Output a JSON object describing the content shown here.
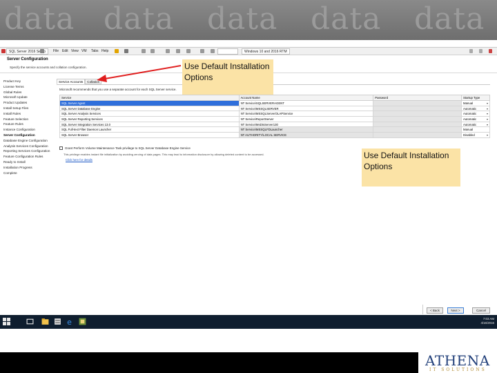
{
  "banner": {
    "watermark": [
      "data",
      "data",
      "data",
      "data",
      "data"
    ]
  },
  "window": {
    "menu": {
      "app_tab": "SQL Server 2016 Setup",
      "items": [
        "File",
        "Edit",
        "View",
        "VM",
        "Tabs",
        "Help"
      ],
      "vm_tab": "Windows 10 and 2016 RTM"
    },
    "header": {
      "title": "Server Configuration",
      "description": "Specify the service accounts and collation configuration."
    },
    "steps": [
      "Product Key",
      "License Terms",
      "Global Rules",
      "Microsoft Update",
      "Product Updates",
      "Install Setup Files",
      "Install Rules",
      "Feature Selection",
      "Feature Rules",
      "Instance Configuration",
      "Server Configuration",
      "Database Engine Configuration",
      "Analysis Services Configuration",
      "Reporting Services Configuration",
      "Feature Configuration Rules",
      "Ready to Install",
      "Installation Progress",
      "Complete"
    ],
    "tabs": {
      "service_accounts": "Service Accounts",
      "collation": "Collation"
    },
    "recommendation": "Microsoft recommends that you use a separate account for each SQL Server service.",
    "table": {
      "headers": [
        "Service",
        "Account Name",
        "Password",
        "Startup Type"
      ],
      "rows": [
        {
          "service": "SQL Server Agent",
          "account": "NT Service\\SQLSERVERAGENT",
          "startup": "Manual"
        },
        {
          "service": "SQL Server Database Engine",
          "account": "NT Service\\MSSQLSERVER",
          "startup": "Automatic"
        },
        {
          "service": "SQL Server Analysis Services",
          "account": "NT Service\\MSSQLServerOLAPService",
          "startup": "Automatic"
        },
        {
          "service": "SQL Server Reporting Services",
          "account": "NT Service\\ReportServer",
          "startup": "Automatic"
        },
        {
          "service": "SQL Server Integration Services 13.0",
          "account": "NT Service\\MsDtsServer130",
          "startup": "Automatic"
        },
        {
          "service": "SQL Full-text Filter Daemon Launcher",
          "account": "NT Service\\MSSQLFDLauncher",
          "startup": "Manual"
        },
        {
          "service": "SQL Server Browser",
          "account": "NT AUTHORITY\\LOCAL SERVICE",
          "startup": "Disabled"
        }
      ]
    },
    "checkbox_label": "Grant Perform Volume Maintenance Task privilege to SQL Server Database Engine Service",
    "checkbox_note": "This privilege enables instant file initialization by avoiding zeroing of data pages. This may lead to information disclosure by allowing deleted content to be accessed.",
    "link": "Click here for details",
    "buttons": {
      "back": "< Back",
      "next": "Next >",
      "cancel": "Cancel"
    }
  },
  "taskbar": {
    "time": "7:03 AM",
    "date": "4/16/2016"
  },
  "callouts": {
    "top": "Use Default Installation Options",
    "right": "Use Default Installation Options"
  },
  "logo": {
    "main": "ATHENA",
    "sub": "IT SOLUTIONS"
  },
  "colors": {
    "banner": "#7a7a7a",
    "callout": "#fbe3a6",
    "arrow": "#e01e1e",
    "taskbar": "#0f1e2f",
    "logo_blue": "#22407a",
    "selection": "#2f6fdb"
  }
}
